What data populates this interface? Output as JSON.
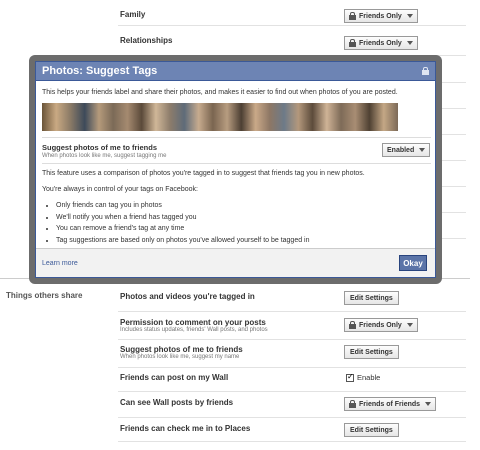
{
  "rows_top": [
    {
      "label": "Family",
      "privacy": "Friends Only"
    },
    {
      "label": "Relationships",
      "privacy": "Friends Only"
    }
  ],
  "section": {
    "label": "Things others share"
  },
  "rows_bottom": [
    {
      "label": "Photos and videos you're tagged in",
      "sub": "",
      "control": "Edit Settings",
      "type": "edit"
    },
    {
      "label": "Permission to comment on your posts",
      "sub": "Includes status updates, friends' Wall posts, and photos",
      "control": "Friends Only",
      "type": "privacy"
    },
    {
      "label": "Suggest photos of me to friends",
      "sub": "When photos look like me, suggest my name",
      "control": "Edit Settings",
      "type": "edit"
    },
    {
      "label": "Friends can post on my Wall",
      "sub": "",
      "control": "Enable",
      "type": "checkbox"
    },
    {
      "label": "Can see Wall posts by friends",
      "sub": "",
      "control": "Friends of Friends",
      "type": "privacy"
    },
    {
      "label": "Friends can check me in to Places",
      "sub": "",
      "control": "Edit Settings",
      "type": "edit"
    }
  ],
  "modal": {
    "title": "Photos: Suggest Tags",
    "intro": "This helps your friends label and share their photos, and makes it easier to find out when photos of you are posted.",
    "setting_label": "Suggest photos of me to friends",
    "setting_sub": "When photos look like me, suggest tagging me",
    "setting_value": "Enabled",
    "feature_text": "This feature uses a comparison of photos you're tagged in to suggest that friends tag you in new photos.",
    "control_text": "You're always in control of your tags on Facebook:",
    "bullets": [
      "Only friends can tag you in photos",
      "We'll notify you when a friend has tagged you",
      "You can remove a friend's tag at any time",
      "Tag suggestions are based only on photos you've allowed yourself to be tagged in"
    ],
    "learn_more": "Learn more",
    "okay": "Okay"
  },
  "colors": {
    "brand": "#3b5998",
    "title_bar": "#6d84b4",
    "overlay": "#6c6c6c"
  },
  "icons": [
    "lock-icon",
    "chevron-down-icon",
    "checkbox-checked-icon"
  ]
}
